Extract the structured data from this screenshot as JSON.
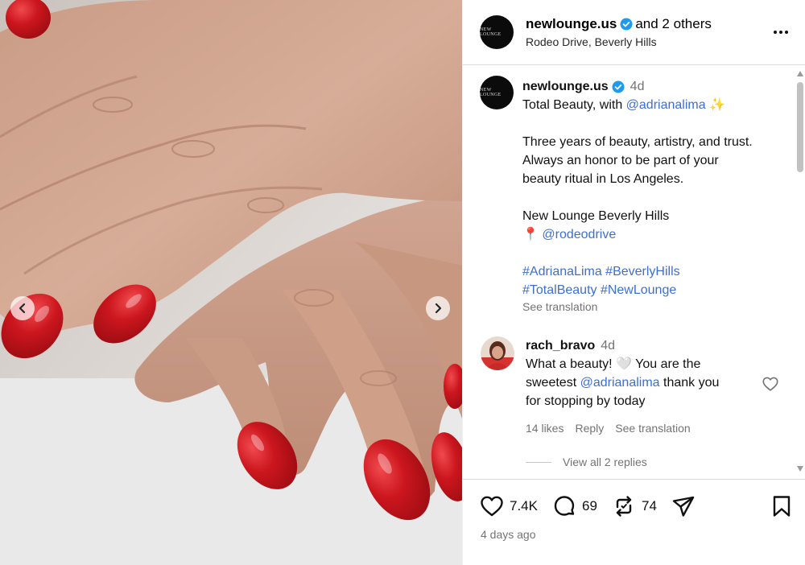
{
  "post_header": {
    "username": "newlounge.us",
    "collaborators": "and 2 others",
    "location": "Rodeo Drive, Beverly Hills",
    "avatar_text": "NEW LOUNGE"
  },
  "caption": {
    "username": "newlounge.us",
    "time": "4d",
    "line1_prefix": "Total Beauty, with ",
    "line1_mention": "@adrianalima",
    "line1_suffix": " ✨",
    "para2_line1": "Three years of beauty, artistry, and trust.",
    "para2_line2": "Always an honor to be part of your",
    "para2_line3": "beauty ritual in Los Angeles.",
    "para3_line1": "New Lounge Beverly Hills",
    "pin": "📍",
    "para3_mention": "@rodeodrive",
    "hashtags_line1": "#AdrianaLima #BeverlyHills",
    "hashtags_line2": "#TotalBeauty #NewLounge",
    "see_translation": "See translation"
  },
  "comment": {
    "username": "rach_bravo",
    "time": "4d",
    "text_part1": "What a beauty! 🤍  You are the",
    "text_part2": "sweetest ",
    "mention": "@adrianalima",
    "text_part3": " thank you",
    "text_part4": "for stopping by today",
    "likes": "14 likes",
    "reply": "Reply",
    "see_translation": "See translation",
    "view_replies": "View all 2 replies"
  },
  "actions": {
    "likes": "7.4K",
    "comments": "69",
    "reposts": "74",
    "date": "4 days ago"
  },
  "colors": {
    "verified": "#1d9bf0",
    "link": "#3d6fd0",
    "muted": "#737373",
    "nail_red": "#c2141c"
  },
  "icons": [
    "chevron-left-icon",
    "chevron-right-icon",
    "verified-badge-icon",
    "more-icon",
    "heart-icon",
    "comment-icon",
    "repost-icon",
    "share-icon",
    "bookmark-icon"
  ]
}
